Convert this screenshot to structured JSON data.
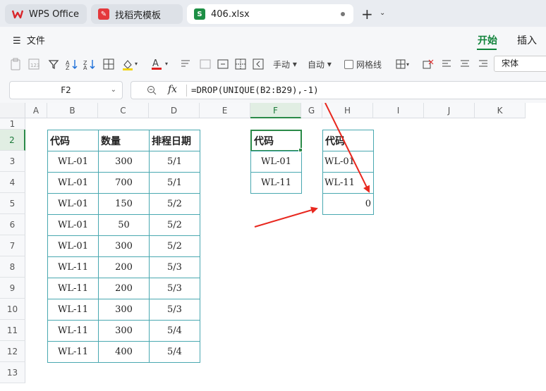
{
  "tabs": [
    {
      "label": "WPS Office",
      "icon": "wps-logo-icon"
    },
    {
      "label": "找稻壳模板",
      "icon": "docer-icon"
    },
    {
      "label": "406.xlsx",
      "icon": "spreadsheet-icon",
      "badge": "S"
    }
  ],
  "menu": {
    "file_label": "文件",
    "ribbon_tabs": [
      "开始",
      "插入"
    ]
  },
  "toolbar": {
    "manual_label": "手动",
    "auto_label": "自动",
    "gridlines_label": "网格线",
    "font_name": "宋体"
  },
  "formula_bar": {
    "cell_ref": "F2",
    "fx_label": "fx",
    "formula": "=DROP(UNIQUE(B2:B29),-1)"
  },
  "columns": [
    "A",
    "B",
    "C",
    "D",
    "E",
    "F",
    "G",
    "H",
    "I",
    "J",
    "K"
  ],
  "rows": [
    "1",
    "2",
    "3",
    "4",
    "5",
    "6",
    "7",
    "8",
    "9",
    "10",
    "11",
    "12",
    "13"
  ],
  "main_table": {
    "headers": [
      "代码",
      "数量",
      "排程日期"
    ],
    "rows": [
      [
        "WL-01",
        "300",
        "5/1"
      ],
      [
        "WL-01",
        "700",
        "5/1"
      ],
      [
        "WL-01",
        "150",
        "5/2"
      ],
      [
        "WL-01",
        "50",
        "5/2"
      ],
      [
        "WL-01",
        "300",
        "5/2"
      ],
      [
        "WL-11",
        "200",
        "5/3"
      ],
      [
        "WL-11",
        "200",
        "5/3"
      ],
      [
        "WL-11",
        "300",
        "5/3"
      ],
      [
        "WL-11",
        "300",
        "5/4"
      ],
      [
        "WL-11",
        "400",
        "5/4"
      ]
    ]
  },
  "f_table": {
    "header": "代码",
    "values": [
      "WL-01",
      "WL-11"
    ]
  },
  "h_table": {
    "header": "代码",
    "values": [
      "WL-01",
      "WL-11",
      "0"
    ]
  },
  "colors": {
    "accent": "#11833b",
    "cell_border": "#49a8b0",
    "arrow": "#e8281f"
  }
}
